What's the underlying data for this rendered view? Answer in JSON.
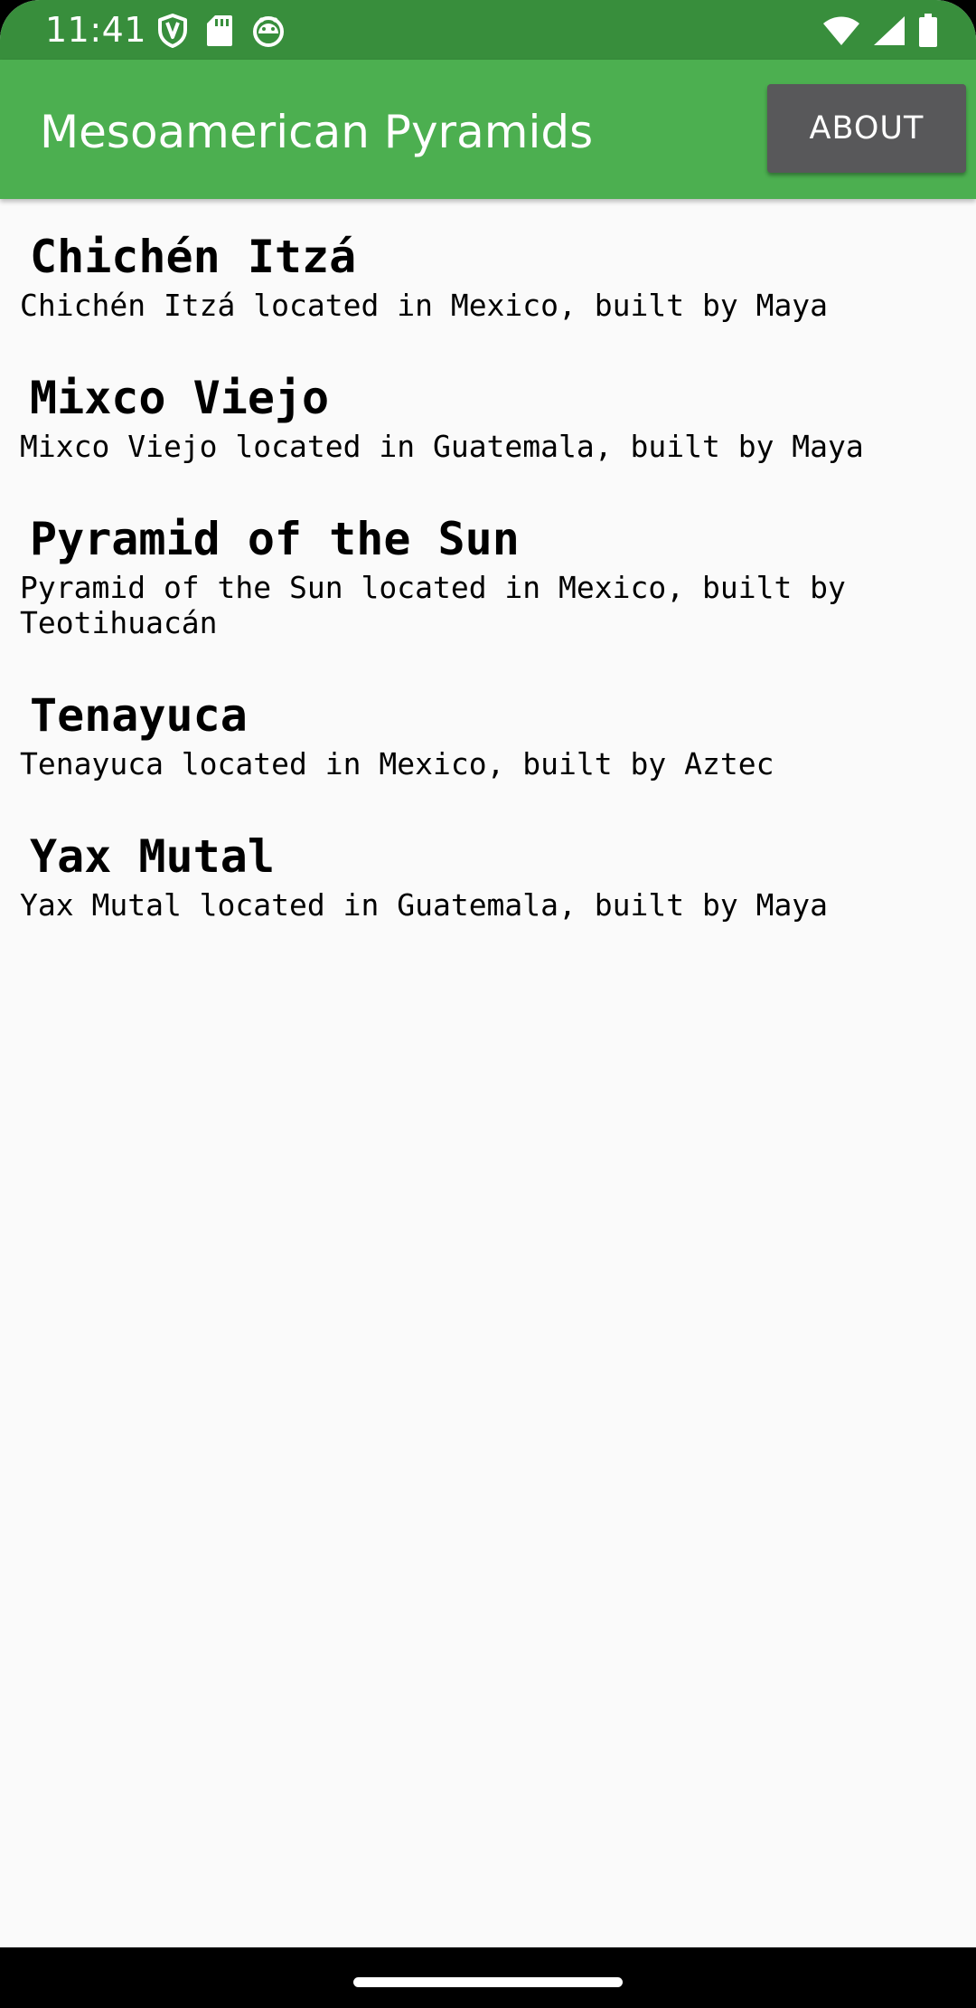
{
  "status_bar": {
    "time": "11:41",
    "left_icons": [
      "shield-icon",
      "sd-card-icon",
      "android-debug-icon"
    ],
    "right_icons": [
      "wifi-icon",
      "signal-icon",
      "battery-icon"
    ],
    "background": "#388e3c"
  },
  "app_bar": {
    "title": "Mesoamerican Pyramids",
    "about_label": "ABOUT",
    "background": "#4caf50",
    "button_background": "#58585a"
  },
  "pyramids": [
    {
      "name": "Chichén Itzá",
      "description": "Chichén Itzá located in Mexico, built by Maya"
    },
    {
      "name": "Mixco Viejo",
      "description": "Mixco Viejo located in Guatemala, built by Maya"
    },
    {
      "name": "Pyramid of the Sun",
      "description": "Pyramid of the Sun located in Mexico, built by Teotihuacán"
    },
    {
      "name": "Tenayuca",
      "description": "Tenayuca located in Mexico, built by Aztec"
    },
    {
      "name": "Yax Mutal",
      "description": "Yax Mutal located in Guatemala, built by Maya"
    }
  ]
}
